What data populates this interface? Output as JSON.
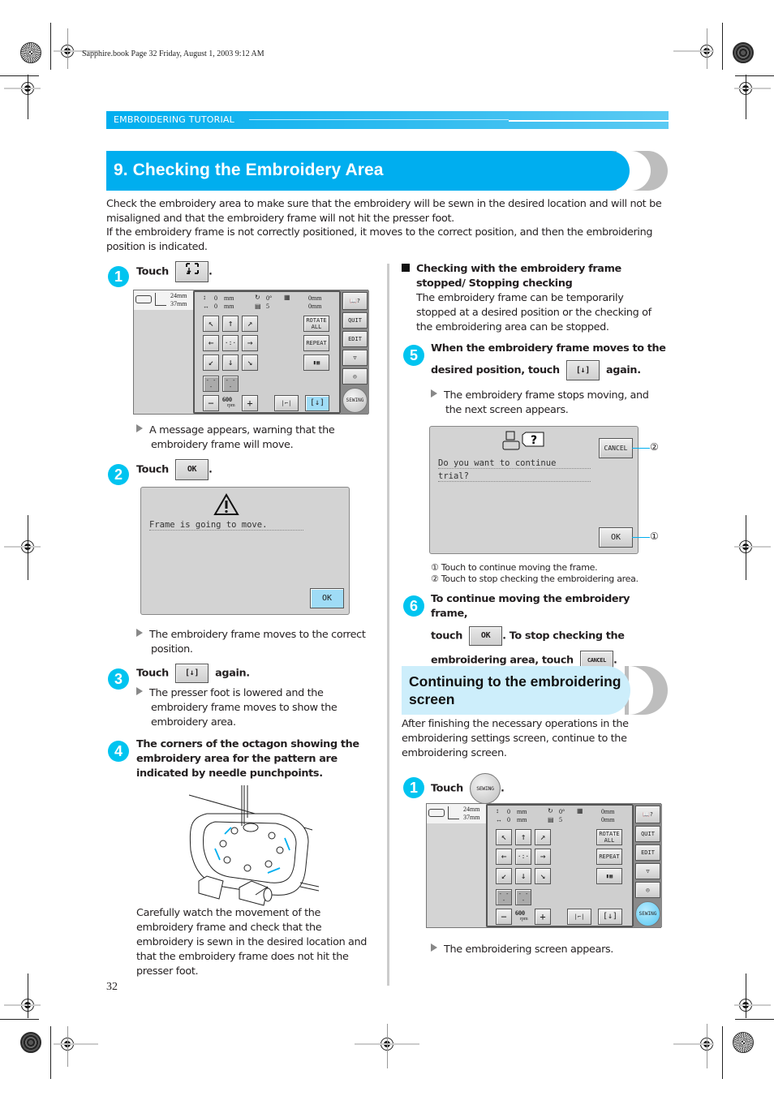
{
  "print_header": "Sapphire.book  Page 32  Friday, August 1, 2003  9:12 AM",
  "section_label": "EMBROIDERING TUTORIAL",
  "title": "9. Checking the Embroidery Area",
  "intro": [
    "Check the embroidery area to make sure that the embroidery will be sewn in the desired location and will not be misaligned and that the embroidery frame will not hit the presser foot.",
    "If the embroidery frame is not correctly positioned, it moves to the correct position, and then the embroidering position is indicated."
  ],
  "colors": {
    "accent": "#00aeef",
    "badge": "#00c4f0",
    "subheading_bg": "#cdeefb",
    "tab_grey": "#bdbdbd",
    "selected_button": "#9fdcf6"
  },
  "left_steps": {
    "step1": {
      "number": "1",
      "touch": "Touch",
      "after": ".",
      "button_icon": "trial-frame-icon",
      "result": "A message appears, warning that the embroidery frame will move."
    },
    "step2": {
      "number": "2",
      "touch": "Touch",
      "button_label": "OK",
      "after": ".",
      "dialog_message": "Frame is going to move.",
      "dialog_ok": "OK",
      "result": "The embroidery frame moves to the correct position."
    },
    "step3": {
      "number": "3",
      "touch": "Touch",
      "after": "again.",
      "result": "The presser foot is lowered and the embroidery frame moves to show the embroidery area."
    },
    "step4": {
      "number": "4",
      "text": "The corners of the octagon showing the embroidery area for the pattern are indicated by needle punchpoints.",
      "note": "Carefully watch the movement of the embroidery frame and check that the embroidery is sewn in the desired location and that the embroidery frame does not hit the presser foot."
    }
  },
  "screen": {
    "size_h": "24mm",
    "size_w": "37mm",
    "offset_v": "0",
    "offset_h": "0",
    "unit": "mm",
    "angle": "0°",
    "color_count": "5",
    "repeat_v": "0mm",
    "repeat_h": "0mm",
    "rotate_all": "ROTATE ALL",
    "repeat": "REPEAT",
    "quit": "QUIT",
    "edit": "EDIT",
    "sewing": "SEWING",
    "speed": "600",
    "speed_unit": "rpm",
    "minus": "−",
    "plus": "+",
    "arrows": [
      "↖",
      "↑",
      "↗",
      "←",
      "·:·",
      "→",
      "↙",
      "↓",
      "↘"
    ]
  },
  "right": {
    "subhead": "Checking with the embroidery frame stopped/ Stopping checking",
    "subhead_body": "The embroidery frame can be temporarily stopped at a desired position or the checking of the embroidering area can be stopped.",
    "step5": {
      "number": "5",
      "line1": "When the embroidery frame moves to the",
      "line2": "desired position, touch",
      "after": "again.",
      "result": "The embroidery frame stops moving, and the next screen appears."
    },
    "dialog": {
      "line1": "Do you want to continue",
      "line2": "trial?",
      "cancel": "CANCEL",
      "ok": "OK",
      "callout1": "①",
      "callout2": "②"
    },
    "notes": [
      "① Touch to continue moving the frame.",
      "② Touch to stop checking the embroidering area."
    ],
    "step6": {
      "number": "6",
      "line1": "To continue moving the embroidery frame,",
      "touch": "touch",
      "ok_label": "OK",
      "mid": ". To stop checking the",
      "line3": "embroidering area, touch",
      "cancel_label": "CANCEL",
      "after": "."
    },
    "section2_title_1": "Continuing to the embroidering",
    "section2_title_2": "screen",
    "section2_body": "After finishing the necessary operations in the embroidering settings screen, continue to the embroidering screen.",
    "step1b": {
      "number": "1",
      "touch": "Touch",
      "button_label": "SEWING",
      "after": ".",
      "result": "The embroidering screen appears."
    }
  },
  "page_number": "32"
}
